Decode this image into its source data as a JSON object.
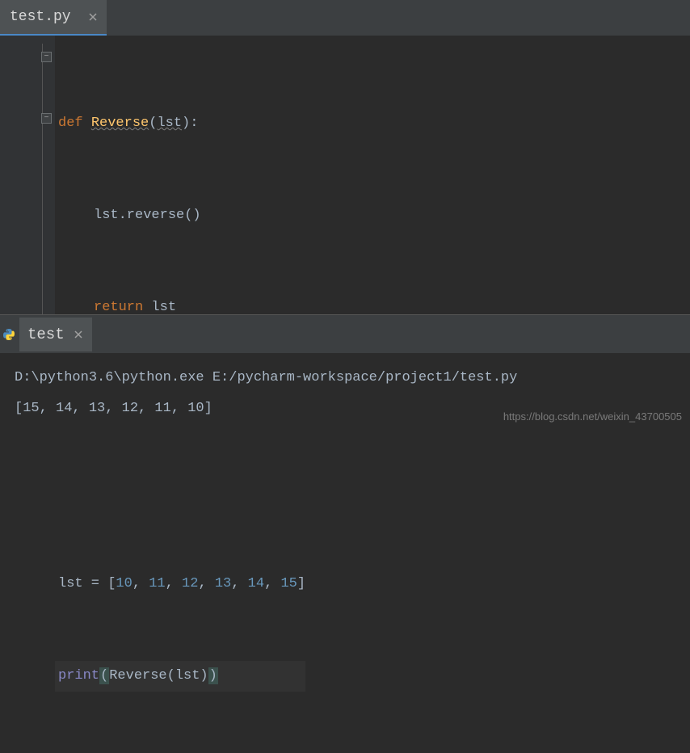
{
  "tab": {
    "filename": "test.py"
  },
  "code": {
    "lines": [
      {
        "type": "def",
        "keyword": "def",
        "name": "Reverse",
        "param": "lst"
      },
      {
        "type": "stmt",
        "text": "lst.reverse()"
      },
      {
        "type": "ret",
        "keyword": "return",
        "var": "lst"
      },
      {
        "type": "blank"
      },
      {
        "type": "blank"
      },
      {
        "type": "assign",
        "raw": "lst = [",
        "nums": [
          "10",
          "11",
          "12",
          "13",
          "14",
          "15"
        ],
        "close": "]"
      },
      {
        "type": "call",
        "builtin": "print",
        "inner": "Reverse(lst)"
      }
    ]
  },
  "run": {
    "name": "test",
    "command": "D:\\python3.6\\python.exe E:/pycharm-workspace/project1/test.py",
    "output": "[15, 14, 13, 12, 11, 10]"
  },
  "watermark": "https://blog.csdn.net/weixin_43700505"
}
